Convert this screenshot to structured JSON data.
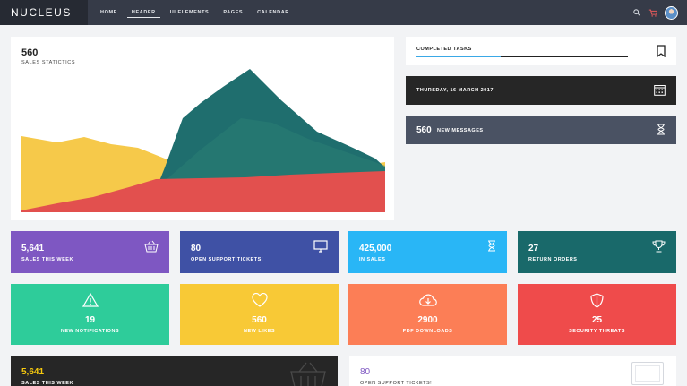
{
  "brand": "NUCLEUS",
  "nav": {
    "items": [
      {
        "label": "HOME",
        "active": false
      },
      {
        "label": "HEADER",
        "active": true
      },
      {
        "label": "UI ELEMENTS",
        "active": false
      },
      {
        "label": "PAGES",
        "active": false
      },
      {
        "label": "CALENDAR",
        "active": false
      }
    ],
    "icons": [
      "search-icon",
      "cart-icon",
      "avatar"
    ]
  },
  "sales": {
    "value": "560",
    "label": "SALES STATICTICS",
    "colors": [
      "#f6c94a",
      "#1f6e6e",
      "#e2504e"
    ]
  },
  "tasks": {
    "title": "COMPLETED TASKS",
    "progress": 0.4,
    "accent": "#3aa8e6",
    "icon": "bookmark-icon"
  },
  "date": {
    "text": "THURSDAY, 16 MARCH 2017",
    "icon": "calendar-icon"
  },
  "messages": {
    "count": "560",
    "label": "NEW MESSAGES",
    "icon": "hourglass-icon"
  },
  "tiles_row1": [
    {
      "value": "5,641",
      "label": "SALES THIS WEEK",
      "color": "#7e57c2",
      "icon": "basket-icon"
    },
    {
      "value": "80",
      "label": "OPEN SUPPORT TICKETS!",
      "color": "#3f51a5",
      "icon": "monitor-icon"
    },
    {
      "value": "425,000",
      "label": "IN SALES",
      "color": "#29b6f6",
      "icon": "hourglass-icon"
    },
    {
      "value": "27",
      "label": "RETURN ORDERS",
      "color": "#19696a",
      "icon": "trophy-icon"
    }
  ],
  "tiles_row2": [
    {
      "value": "19",
      "label": "NEW NOTIFICATIONS",
      "color": "#2ecc9a",
      "icon": "warning-icon"
    },
    {
      "value": "560",
      "label": "NEW LIKES",
      "color": "#f8c936",
      "icon": "heart-icon"
    },
    {
      "value": "2900",
      "label": "PDF DOWNLOADS",
      "color": "#fc7e56",
      "icon": "cloud-download-icon"
    },
    {
      "value": "25",
      "label": "SECURITY THREATS",
      "color": "#ef4b4b",
      "icon": "shield-icon"
    }
  ],
  "bottom_dark": {
    "value": "5,641",
    "label": "SALES THIS WEEK",
    "icon": "basket-icon"
  },
  "bottom_white": {
    "value": "80",
    "label": "OPEN SUPPORT TICKETS!",
    "icon": "monitor-icon"
  }
}
